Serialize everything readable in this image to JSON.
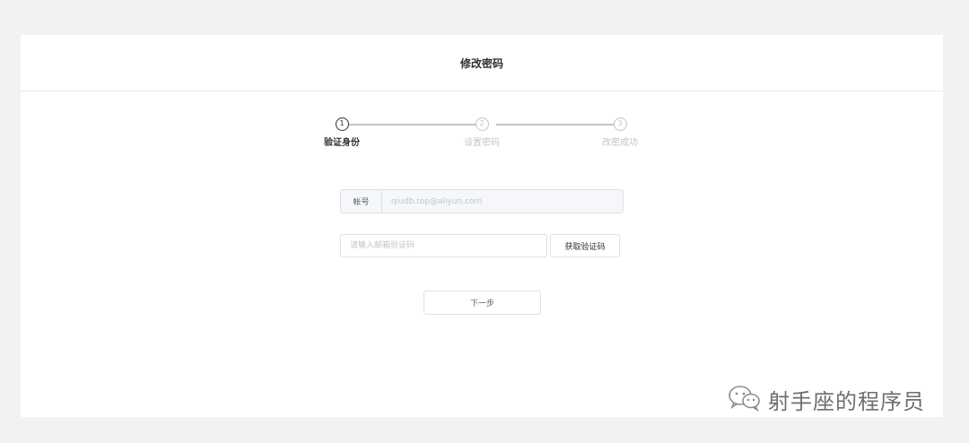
{
  "header": {
    "title": "修改密码"
  },
  "steps": [
    {
      "number": "1",
      "label": "验证身份",
      "active": true
    },
    {
      "number": "2",
      "label": "设置密码",
      "active": false
    },
    {
      "number": "3",
      "label": "改密成功",
      "active": false
    }
  ],
  "form": {
    "account_label": "帐号",
    "account_value": "qiudb.top@aliyun.com",
    "code_placeholder": "请输入邮箱验证码",
    "code_value": "",
    "get_code_label": "获取验证码",
    "next_label": "下一步"
  },
  "watermark": {
    "icon": "wechat-icon",
    "text": "射手座的程序员"
  },
  "colors": {
    "background": "#f2f2f2",
    "card": "#ffffff",
    "active_step": "#303133",
    "inactive_step": "#c0c4cc"
  }
}
